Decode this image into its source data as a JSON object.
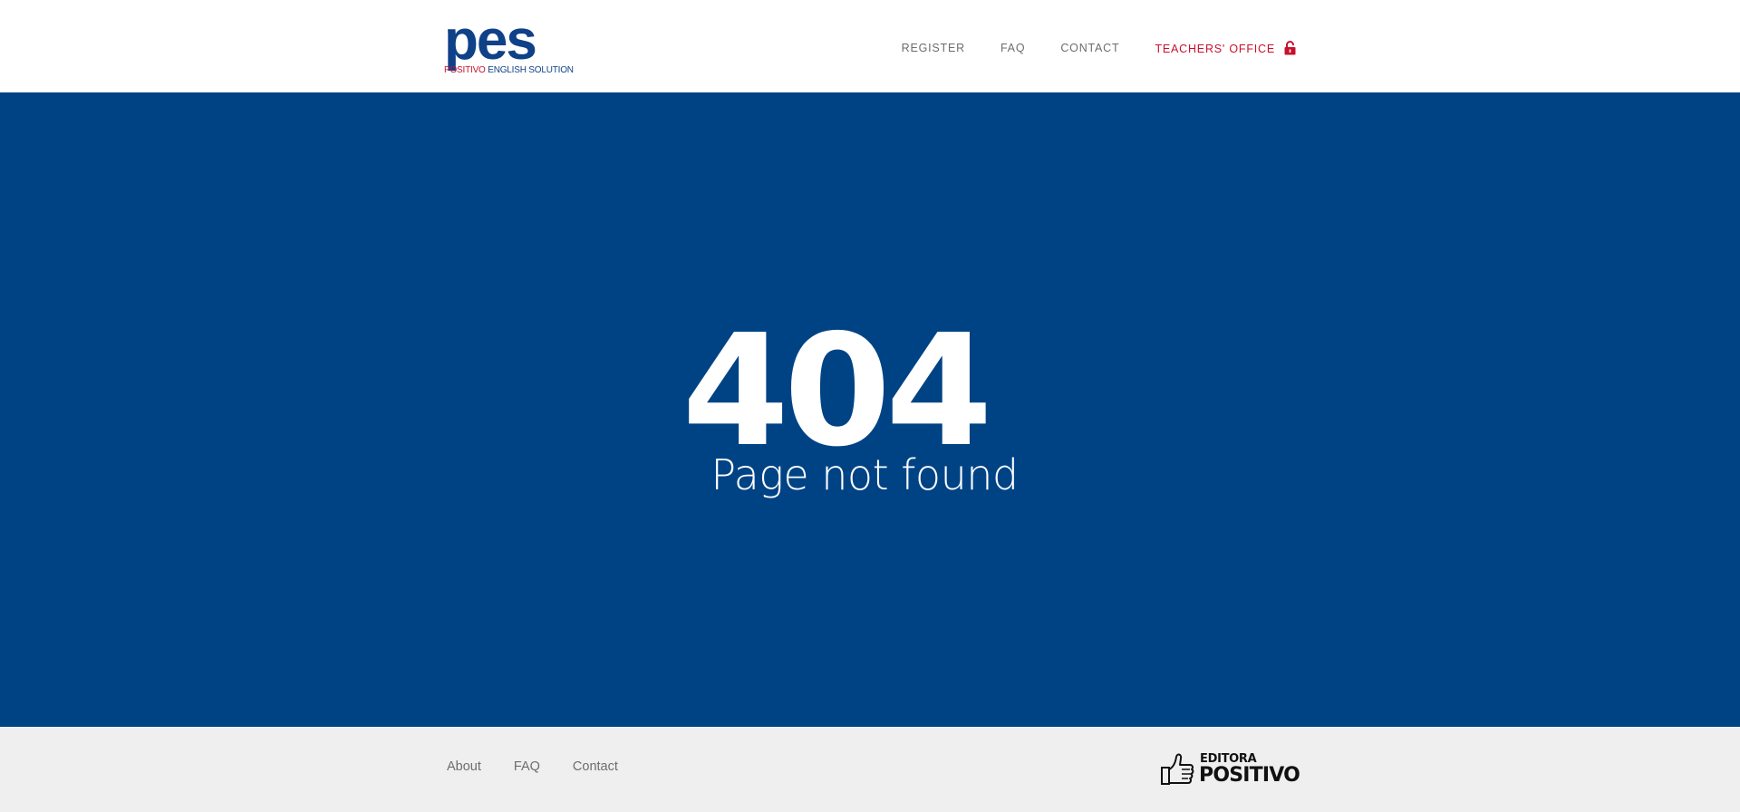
{
  "header": {
    "logo": {
      "mark": "pes",
      "subtitle_red": "POSITIVO",
      "subtitle_blue": " ENGLISH SOLUTION"
    },
    "nav": [
      {
        "label": "REGISTER"
      },
      {
        "label": "FAQ"
      },
      {
        "label": "CONTACT"
      },
      {
        "label": "TEACHERS' OFFICE",
        "icon": "lock-icon"
      }
    ]
  },
  "main": {
    "error_code": "404",
    "error_message": "Page not found"
  },
  "footer": {
    "links": [
      {
        "label": "About"
      },
      {
        "label": "FAQ"
      },
      {
        "label": "Contact"
      }
    ],
    "brand": {
      "line1": "EDITORA",
      "line2": "POSITIVO",
      "icon": "thumbs-up-icon"
    }
  },
  "colors": {
    "brand_blue": "#004385",
    "logo_blue": "#0f4189",
    "accent_red": "#c8102e",
    "nav_gray": "#6d6d6d",
    "footer_bg": "#efefef"
  }
}
